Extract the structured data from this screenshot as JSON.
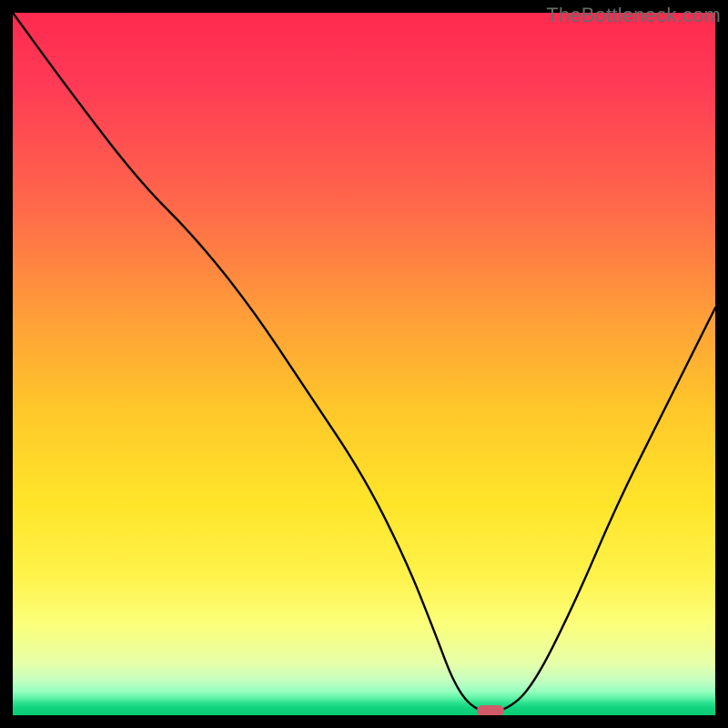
{
  "watermark": "TheBottleneck.com",
  "colors": {
    "frame": "#000000",
    "curve_stroke": "#000000",
    "marker_fill": "#d15a6a",
    "gradient_top": "#ff2a4f",
    "gradient_bottom": "#0acb72"
  },
  "chart_data": {
    "type": "line",
    "title": "",
    "xlabel": "",
    "ylabel": "",
    "xlim": [
      0,
      100
    ],
    "ylim": [
      0,
      100
    ],
    "grid": false,
    "series": [
      {
        "name": "bottleneck-curve",
        "x": [
          0,
          8,
          18,
          26,
          34,
          42,
          50,
          56,
          60,
          63,
          66,
          70,
          74,
          80,
          86,
          92,
          100
        ],
        "y": [
          100,
          89,
          76,
          68,
          58,
          46,
          34,
          22,
          12,
          4,
          0.5,
          0.5,
          4,
          16,
          30,
          42,
          58
        ]
      }
    ],
    "marker": {
      "name": "optimal-point",
      "x": 68,
      "y": 0.6,
      "color": "#d15a6a"
    }
  }
}
